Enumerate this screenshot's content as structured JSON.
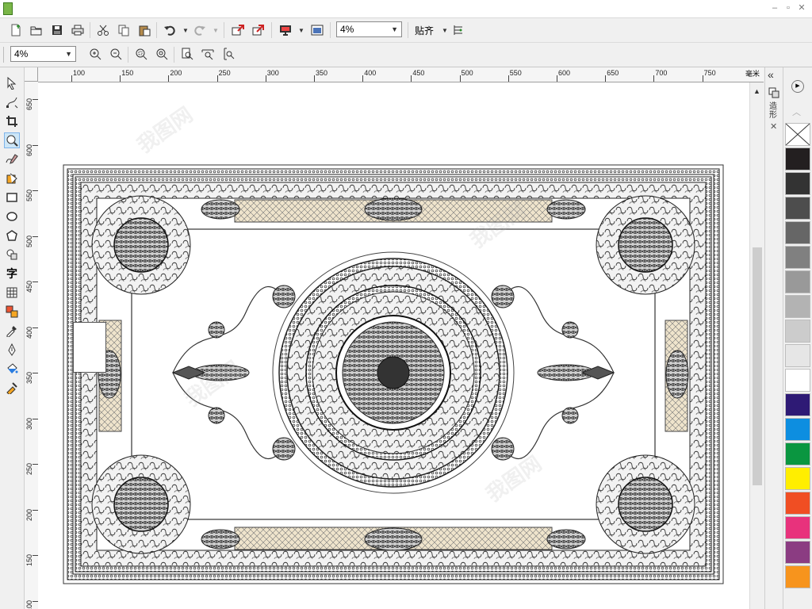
{
  "window": {
    "minimize_glyph": "–",
    "restore_glyph": "▫",
    "close_glyph": "✕"
  },
  "toolbar": {
    "zoom_value": "4%",
    "snap_label": "贴齐",
    "icons": [
      "new-document-icon",
      "open-folder-icon",
      "save-icon",
      "print-icon",
      "cut-icon",
      "copy-icon",
      "paste-icon",
      "undo-icon",
      "redo-icon",
      "import-icon",
      "export-icon",
      "publish-icon",
      "application-launcher-icon",
      "snap-options-icon"
    ]
  },
  "zoom_toolbar": {
    "zoom_value": "4%",
    "icons": [
      "zoom-in-icon",
      "zoom-out-icon",
      "zoom-selected-icon",
      "zoom-all-icon",
      "zoom-page-icon",
      "zoom-width-icon",
      "zoom-height-icon"
    ]
  },
  "toolbox": {
    "text_tool_glyph": "字",
    "icons": [
      "pick-tool-icon",
      "shape-tool-icon",
      "crop-tool-icon",
      "zoom-tool-icon",
      "freehand-tool-icon",
      "smart-fill-icon",
      "rectangle-tool-icon",
      "ellipse-tool-icon",
      "polygon-tool-icon",
      "basic-shapes-icon",
      "text-tool-icon",
      "table-tool-icon",
      "interactive-blend-icon",
      "eyedropper-icon",
      "outline-pen-icon",
      "fill-icon",
      "interactive-fill-icon"
    ]
  },
  "rulers": {
    "horizontal_labels": [
      "100",
      "150",
      "200",
      "250",
      "300",
      "350",
      "400",
      "450",
      "500",
      "550",
      "600",
      "650",
      "700",
      "750"
    ],
    "vertical_labels": [
      "650",
      "600",
      "550",
      "500",
      "450",
      "400",
      "350",
      "300",
      "250",
      "200",
      "150",
      "100"
    ],
    "unit": "毫米"
  },
  "docker": {
    "tab_label": "造形",
    "collapse_glyph": "«",
    "close_glyph": "✕"
  },
  "palette": {
    "no_color_label": "No color",
    "swatches": [
      "#231f20",
      "#333333",
      "#4d4d4d",
      "#666666",
      "#808080",
      "#999999",
      "#b3b3b3",
      "#cccccc",
      "#e6e6e6",
      "#ffffff",
      "#2e1a75",
      "#0d8ee0",
      "#0a9640",
      "#ffee00",
      "#f04e23",
      "#e8327c",
      "#8b3c82",
      "#f7941d"
    ]
  },
  "watermark": "我图网"
}
